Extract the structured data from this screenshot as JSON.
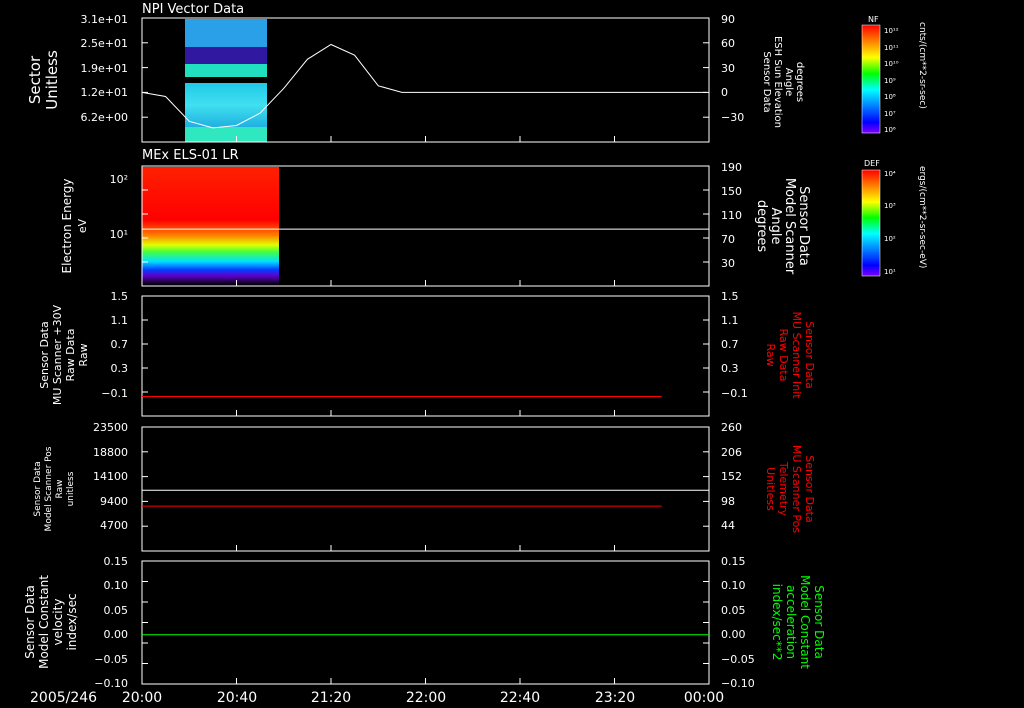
{
  "chart_data": [
    {
      "type": "heatmap",
      "title": "NPI Vector Data",
      "ylabel_left": [
        "Sector",
        "Unitless"
      ],
      "yticks_left": [
        "3.1e+01",
        "2.5e+01",
        "1.9e+01",
        "1.2e+01",
        "6.2e+00"
      ],
      "ylabel_right": [
        "Sensor Data",
        "ESH Sun Elevation",
        "Angle",
        "degrees"
      ],
      "yticks_right": [
        "90",
        "60",
        "30",
        "0",
        "−30"
      ],
      "ylim_right": [
        -60,
        90
      ],
      "line_series": {
        "name": "",
        "color": "#ffffff",
        "x": [
          "20:00",
          "20:10",
          "20:20",
          "20:30",
          "20:40",
          "20:50",
          "21:00",
          "21:10",
          "21:20",
          "21:30",
          "21:40",
          "21:50",
          "22:00",
          "23:59"
        ],
        "y": [
          0,
          -5,
          -35,
          -43,
          -40,
          -25,
          5,
          40,
          58,
          45,
          8,
          0,
          0,
          0
        ]
      },
      "spectrogram_extent": [
        "20:15",
        "20:45"
      ],
      "colorbar": {
        "label": "NF",
        "units": "cnts/(cm**2-sr-sec)",
        "ticks": [
          "10¹²",
          "10¹¹",
          "10¹⁰",
          "10⁹",
          "10⁸",
          "10⁷",
          "10⁶"
        ]
      }
    },
    {
      "type": "heatmap",
      "title": "MEx ELS-01 LR",
      "ylabel_left": [
        "Electron Energy",
        "eV"
      ],
      "yticks_left": [
        "10²",
        "10¹"
      ],
      "ylabel_right": [
        "Sensor Data",
        "Model Scanner",
        "Angle",
        "degrees"
      ],
      "yticks_right": [
        "190",
        "150",
        "110",
        "70",
        "30"
      ],
      "ylim_right": [
        0,
        190
      ],
      "line_series": {
        "name": "",
        "color": "#ffffff",
        "x": [
          "20:00",
          "00:00"
        ],
        "y": [
          90,
          90
        ]
      },
      "spectrogram_extent": [
        "20:00",
        "20:50"
      ],
      "colorbar": {
        "label": "DEF",
        "units": "ergs/(cm**2-sr-sec-eV)",
        "ticks": [
          "10⁴",
          "10³",
          "10²",
          "10¹"
        ]
      }
    },
    {
      "type": "line",
      "ylabel_left": [
        "Sensor Data",
        "MU Scanner +30V",
        "Raw Data",
        "Raw"
      ],
      "yticks_left": [
        "1.5",
        "1.1",
        "0.7",
        "0.3",
        "−0.1"
      ],
      "ylabel_right": [
        "Sensor Data",
        "MU Scanner Init",
        "Raw Data",
        "Raw"
      ],
      "yticks_right": [
        "1.5",
        "1.1",
        "0.7",
        "0.3",
        "−0.1"
      ],
      "ylim": [
        -0.35,
        1.5
      ],
      "series": [
        {
          "name": "",
          "color": "#ff0000",
          "x": [
            "20:00",
            "23:40"
          ],
          "y": [
            -0.05,
            -0.05
          ]
        }
      ]
    },
    {
      "type": "line",
      "ylabel_left": [
        "Sensor Data",
        "Model Scanner Pos",
        "Raw",
        "unitless"
      ],
      "yticks_left": [
        "23500",
        "18800",
        "14100",
        "9400",
        "4700"
      ],
      "ylabel_right": [
        "Sensor Data",
        "MU Scanner Pos",
        "Telemetry",
        "Unitless"
      ],
      "yticks_right": [
        "260",
        "206",
        "152",
        "98",
        "44"
      ],
      "ylim": [
        0,
        23500
      ],
      "series": [
        {
          "name": "",
          "color": "#ffffff",
          "x": [
            "20:00",
            "00:00"
          ],
          "y": [
            11500,
            11500
          ]
        },
        {
          "name": "",
          "color": "#ff0000",
          "x": [
            "20:00",
            "23:40"
          ],
          "y": [
            8500,
            8500
          ]
        }
      ]
    },
    {
      "type": "line",
      "ylabel_left": [
        "Sensor Data",
        "Model Constant",
        "velocity",
        "index/sec"
      ],
      "yticks_left": [
        "0.15",
        "0.10",
        "0.05",
        "0.00",
        "−0.05",
        "−0.10"
      ],
      "ylabel_right": [
        "Sensor Data",
        "Model Constant",
        "acceleration",
        "index/sec**2"
      ],
      "yticks_right": [
        "0.15",
        "0.10",
        "0.05",
        "0.00",
        "−0.05",
        "−0.10"
      ],
      "ylim": [
        -0.1,
        0.15
      ],
      "series": [
        {
          "name": "",
          "color": "#00ff00",
          "x": [
            "20:00",
            "00:00"
          ],
          "y": [
            0,
            0
          ]
        }
      ]
    }
  ],
  "time_axis": {
    "date_label": "2005/246",
    "ticks": [
      "20:00",
      "20:40",
      "21:20",
      "22:00",
      "22:40",
      "23:20",
      "00:00"
    ],
    "range": [
      "20:00",
      "00:00"
    ]
  },
  "colors": {
    "background": "#000000",
    "axes": "#ffffff",
    "panel3_right_label": "#ff0000",
    "panel4_right_label": "#ff0000",
    "panel5_right_label": "#00ff00"
  }
}
